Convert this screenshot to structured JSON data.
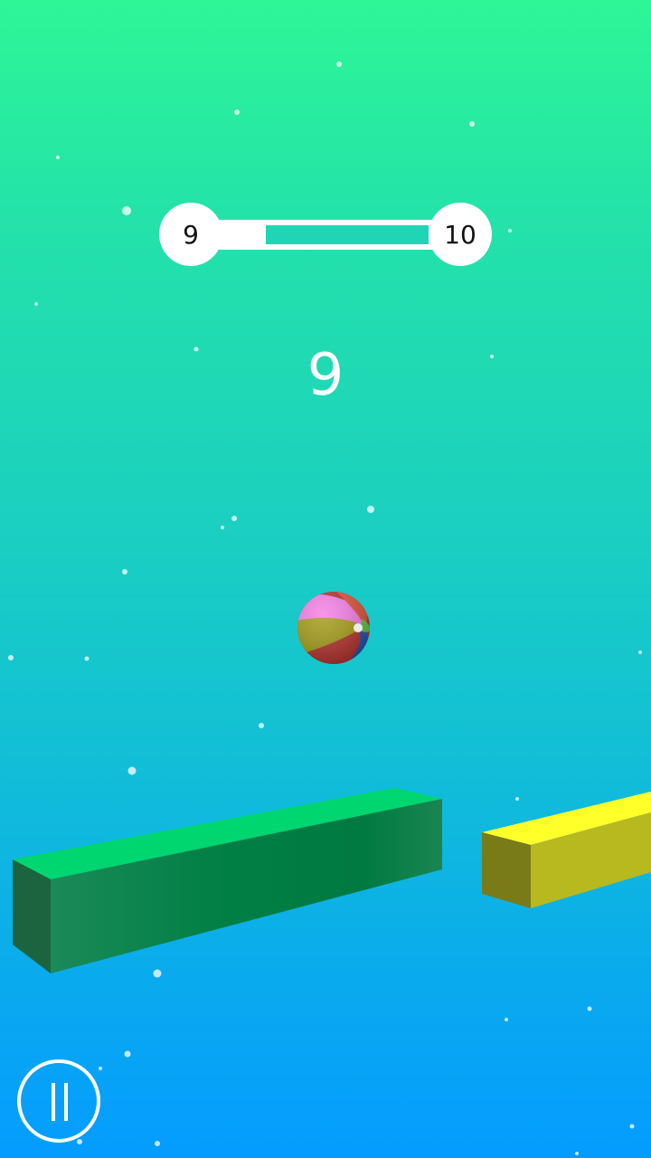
{
  "level": {
    "current": "9",
    "next": "10",
    "progress": 0
  },
  "score": "9",
  "controls": {
    "pause": "pause-icon"
  },
  "colors": {
    "platform_green": "#00d66f",
    "platform_yellow": "#ffff2a"
  }
}
